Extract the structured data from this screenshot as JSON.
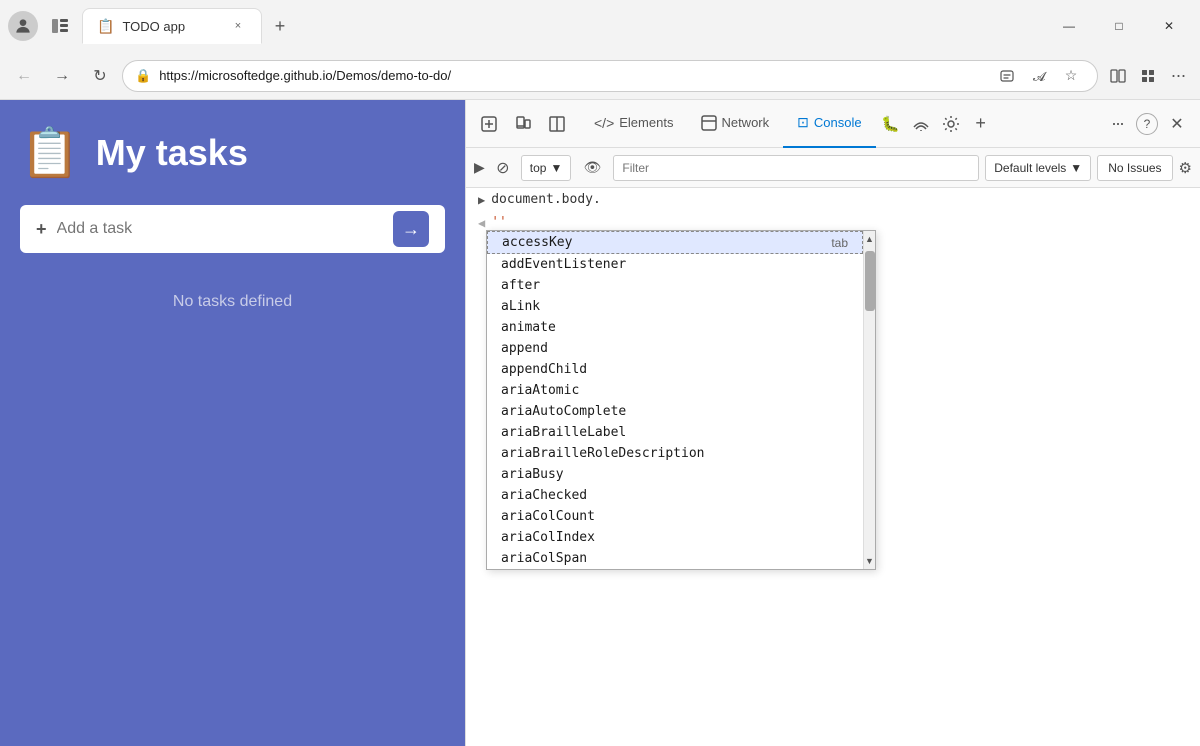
{
  "browser": {
    "profile_icon": "👤",
    "tab": {
      "favicon": "📋",
      "title": "TODO app",
      "close_label": "×"
    },
    "new_tab_label": "+",
    "window_controls": {
      "minimize": "—",
      "maximize": "□",
      "close": "✕"
    },
    "address": {
      "url": "https://microsoftedge.github.io/Demos/demo-to-do/",
      "lock_icon": "🔒"
    },
    "nav": {
      "back": "←",
      "forward": "→",
      "refresh": "↻"
    }
  },
  "todo_app": {
    "icon": "📋",
    "title": "My tasks",
    "add_placeholder": "Add a task",
    "add_icon": "+",
    "add_btn_icon": "→",
    "no_tasks": "No tasks defined"
  },
  "devtools": {
    "toolbar_icons": [
      "inspect",
      "device",
      "layout",
      "home",
      "code",
      "console-tab",
      "bug",
      "wifi",
      "settings-gear",
      "add"
    ],
    "tabs": [
      {
        "id": "elements",
        "label": "Elements",
        "icon": "</>",
        "active": false
      },
      {
        "id": "console",
        "label": "Console",
        "icon": "☰",
        "active": true
      }
    ],
    "more_icon": "···",
    "help_icon": "?",
    "close_icon": "✕",
    "console_bar": {
      "expand_icon": "▶",
      "no_icon": "⊘",
      "top_label": "top",
      "dropdown_icon": "▼",
      "eye_icon": "👁",
      "filter_placeholder": "Filter",
      "level_label": "Default levels",
      "level_dropdown": "▼",
      "no_issues": "No Issues",
      "gear_icon": "⚙"
    },
    "console_lines": [
      {
        "type": "arrow",
        "text": "document.body."
      },
      {
        "type": "quote",
        "text": "''"
      }
    ],
    "autocomplete": {
      "items": [
        {
          "label": "accessKey",
          "hint": "tab",
          "first": true
        },
        {
          "label": "addEventListener"
        },
        {
          "label": "after"
        },
        {
          "label": "aLink"
        },
        {
          "label": "animate"
        },
        {
          "label": "append"
        },
        {
          "label": "appendChild"
        },
        {
          "label": "ariaAtomic"
        },
        {
          "label": "ariaAutoComplete"
        },
        {
          "label": "ariaBrailleLabel"
        },
        {
          "label": "ariaBrailleRoleDescription"
        },
        {
          "label": "ariaBusy"
        },
        {
          "label": "ariaChecked"
        },
        {
          "label": "ariaColCount"
        },
        {
          "label": "ariaColIndex"
        },
        {
          "label": "ariaColSpan"
        }
      ]
    }
  }
}
